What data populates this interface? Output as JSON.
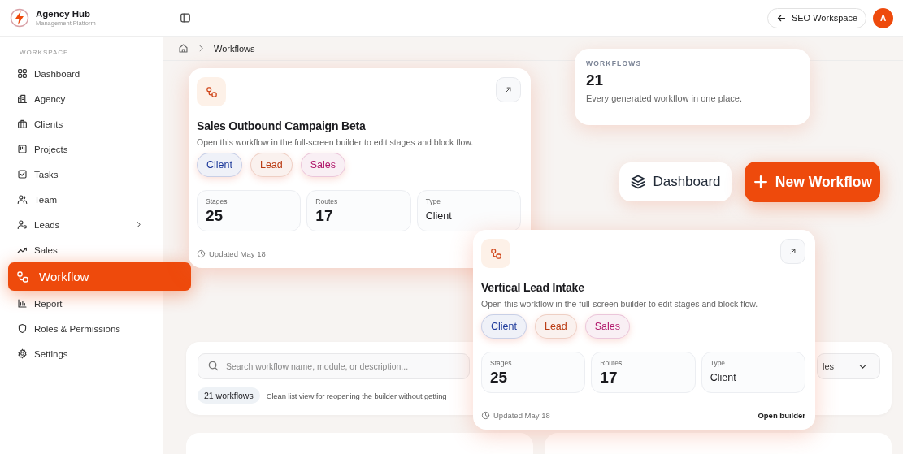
{
  "brand": {
    "name": "Agency Hub",
    "subtitle": "Management Platform"
  },
  "sidebar": {
    "section": "WORKSPACE",
    "items": [
      {
        "label": "Dashboard",
        "selected": false,
        "submenu": false
      },
      {
        "label": "Agency",
        "selected": false,
        "submenu": false
      },
      {
        "label": "Clients",
        "selected": false,
        "submenu": false
      },
      {
        "label": "Projects",
        "selected": false,
        "submenu": false
      },
      {
        "label": "Tasks",
        "selected": false,
        "submenu": false
      },
      {
        "label": "Team",
        "selected": false,
        "submenu": false
      },
      {
        "label": "Leads",
        "selected": false,
        "submenu": true
      },
      {
        "label": "Sales",
        "selected": false,
        "submenu": false
      },
      {
        "label": "Workflow",
        "selected": true,
        "submenu": false
      },
      {
        "label": "Report",
        "selected": false,
        "submenu": false
      },
      {
        "label": "Roles & Permissions",
        "selected": false,
        "submenu": false
      },
      {
        "label": "Settings",
        "selected": false,
        "submenu": false
      }
    ]
  },
  "topbar": {
    "workspace_button": "SEO Workspace",
    "avatar": "A"
  },
  "breadcrumb": [
    "Workflows"
  ],
  "stat_card": {
    "label": "WORKFLOWS",
    "value": "21",
    "caption": "Every generated workflow in one place."
  },
  "actions": {
    "secondary": "Dashboard",
    "primary": "New Workflow"
  },
  "filters": {
    "search_placeholder": "Search workflow name, module, or description...",
    "dropdown_value": "les",
    "count": "21 workflows",
    "note": "Clean list view for reopening the builder without getting"
  },
  "workflow_cards": [
    {
      "title": "Sales Outbound Campaign Beta",
      "description": "Open this workflow in the full-screen builder to edit stages and block flow.",
      "tags": [
        {
          "label": "Client",
          "color": "#1e3a9a"
        },
        {
          "label": "Lead",
          "color": "#b93a12"
        },
        {
          "label": "Sales",
          "color": "#b0176a"
        }
      ],
      "stats": [
        {
          "label": "Stages",
          "value": "25",
          "kind": "number"
        },
        {
          "label": "Routes",
          "value": "17",
          "kind": "number"
        },
        {
          "label": "Type",
          "value": "Client",
          "kind": "text"
        }
      ],
      "updated": "Updated May 18"
    },
    {
      "title": "Vertical Lead Intake",
      "description": "Open this workflow in the full-screen builder to edit stages and block flow.",
      "tags": [
        {
          "label": "Client",
          "color": "#1e3a9a"
        },
        {
          "label": "Lead",
          "color": "#b93a12"
        },
        {
          "label": "Sales",
          "color": "#b0176a"
        }
      ],
      "stats": [
        {
          "label": "Stages",
          "value": "25",
          "kind": "number"
        },
        {
          "label": "Routes",
          "value": "17",
          "kind": "number"
        },
        {
          "label": "Type",
          "value": "Client",
          "kind": "text"
        }
      ],
      "updated": "Updated May 18",
      "link": "Open builder"
    }
  ]
}
